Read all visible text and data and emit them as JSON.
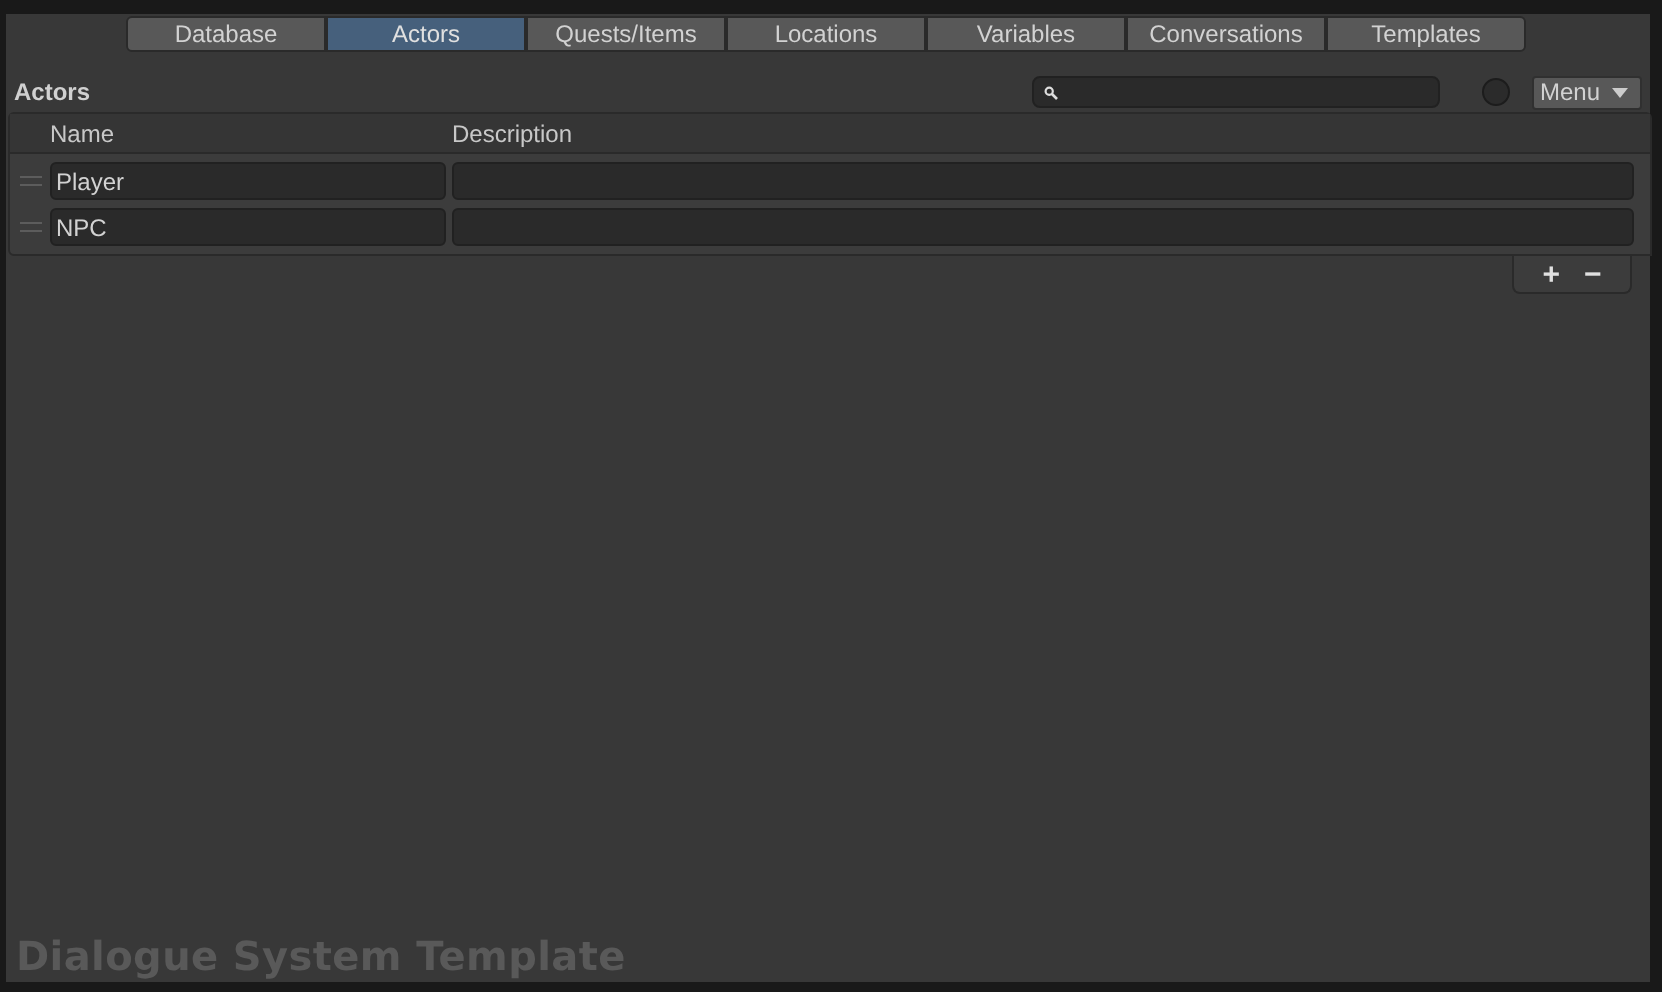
{
  "tabs": [
    {
      "label": "Database",
      "selected": false
    },
    {
      "label": "Actors",
      "selected": true
    },
    {
      "label": "Quests/Items",
      "selected": false
    },
    {
      "label": "Locations",
      "selected": false
    },
    {
      "label": "Variables",
      "selected": false
    },
    {
      "label": "Conversations",
      "selected": false
    },
    {
      "label": "Templates",
      "selected": false
    }
  ],
  "section": {
    "title": "Actors",
    "menu": "Menu"
  },
  "table": {
    "columns": [
      "Name",
      "Description"
    ],
    "rows": [
      {
        "name": "Player"
      },
      {
        "name": "NPC"
      }
    ]
  },
  "footer_buttons": [
    "+",
    "−"
  ],
  "watermark": "Dialogue System Template"
}
